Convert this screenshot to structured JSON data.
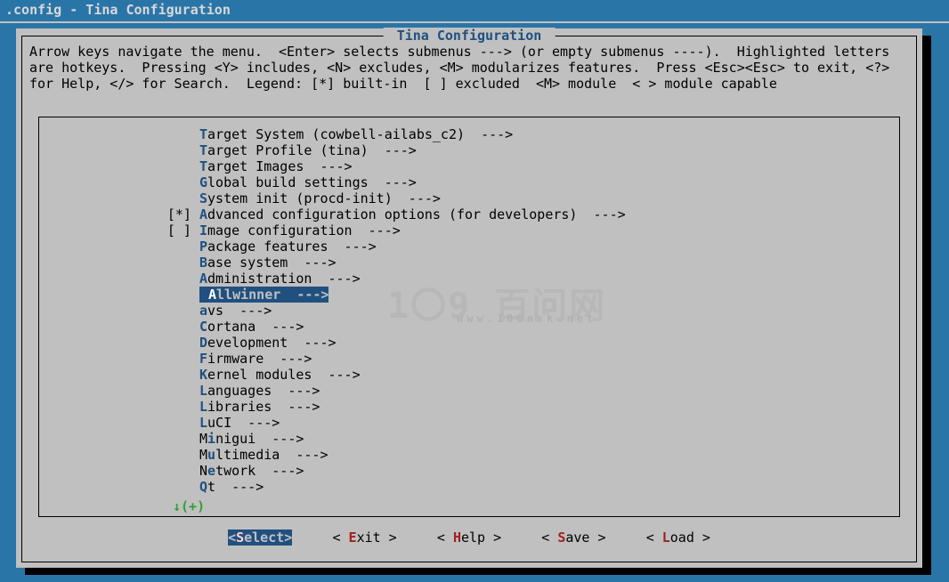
{
  "window_title": ".config - Tina Configuration",
  "dialog_title": " Tina Configuration ",
  "help_lines": "Arrow keys navigate the menu.  <Enter> selects submenus ---> (or empty submenus ----).  Highlighted letters\nare hotkeys.  Pressing <Y> includes, <N> excludes, <M> modularizes features.  Press <Esc><Esc> to exit, <?>\nfor Help, </> for Search.  Legend: [*] built-in  [ ] excluded  <M> module  < > module capable",
  "menu": [
    {
      "prefix": "    ",
      "hot": "T",
      "rest": "arget System (cowbell-ailabs_c2)  --->",
      "selected": false
    },
    {
      "prefix": "    ",
      "hot": "T",
      "rest": "arget Profile (tina)  --->",
      "selected": false
    },
    {
      "prefix": "    ",
      "hot": "T",
      "rest": "arget Images  --->",
      "selected": false
    },
    {
      "prefix": "    ",
      "hot": "G",
      "rest": "lobal build settings  --->",
      "selected": false
    },
    {
      "prefix": "    ",
      "hot": "S",
      "rest": "ystem init (procd-init)  --->",
      "selected": false
    },
    {
      "prefix": "[*] ",
      "hot": "A",
      "rest": "dvanced configuration options (for developers)  --->",
      "selected": false
    },
    {
      "prefix": "[ ] ",
      "hot": "I",
      "rest": "mage configuration  --->",
      "selected": false
    },
    {
      "prefix": "    ",
      "hot": "P",
      "rest": "ackage features  --->",
      "selected": false
    },
    {
      "prefix": "    ",
      "hot": "B",
      "rest": "ase system  --->",
      "selected": false
    },
    {
      "prefix": "    ",
      "hot": "A",
      "rest": "dministration  --->",
      "selected": false
    },
    {
      "prefix": "    ",
      "hot": "A",
      "rest": "llwinner  --->",
      "selected": true
    },
    {
      "prefix": "    ",
      "hot": "a",
      "rest": "vs  --->",
      "selected": false
    },
    {
      "prefix": "    ",
      "hot": "C",
      "rest": "ortana  --->",
      "selected": false
    },
    {
      "prefix": "    ",
      "hot": "D",
      "rest": "evelopment  --->",
      "selected": false
    },
    {
      "prefix": "    ",
      "hot": "F",
      "rest": "irmware  --->",
      "selected": false
    },
    {
      "prefix": "    ",
      "hot": "K",
      "rest": "ernel modules  --->",
      "selected": false
    },
    {
      "prefix": "    ",
      "hot": "L",
      "rest": "anguages  --->",
      "selected": false
    },
    {
      "prefix": "    ",
      "hot": "L",
      "rest": "ibraries  --->",
      "selected": false
    },
    {
      "prefix": "    ",
      "hot": "L",
      "rest": "uCI  --->",
      "selected": false
    },
    {
      "prefix": "    ",
      "hot": "",
      "rest": "",
      "custom": "Minigui",
      "selected": false
    },
    {
      "prefix": "    ",
      "hot": "",
      "rest": "",
      "custom": "Multimedia",
      "selected": false
    },
    {
      "prefix": "    ",
      "hot": "",
      "rest": "",
      "custom": "Network",
      "selected": false
    },
    {
      "prefix": "    ",
      "hot": "Q",
      "rest": "t  --->",
      "selected": false
    }
  ],
  "more_indicator": "↓(+)",
  "buttons": [
    {
      "label": "Select",
      "selected": true
    },
    {
      "label": "Exit",
      "selected": false
    },
    {
      "label": "Help",
      "selected": false
    },
    {
      "label": "Save",
      "selected": false
    },
    {
      "label": "Load",
      "selected": false
    }
  ],
  "watermark": {
    "big": "1〇9 百问网",
    "small": "www.100ask.net"
  }
}
